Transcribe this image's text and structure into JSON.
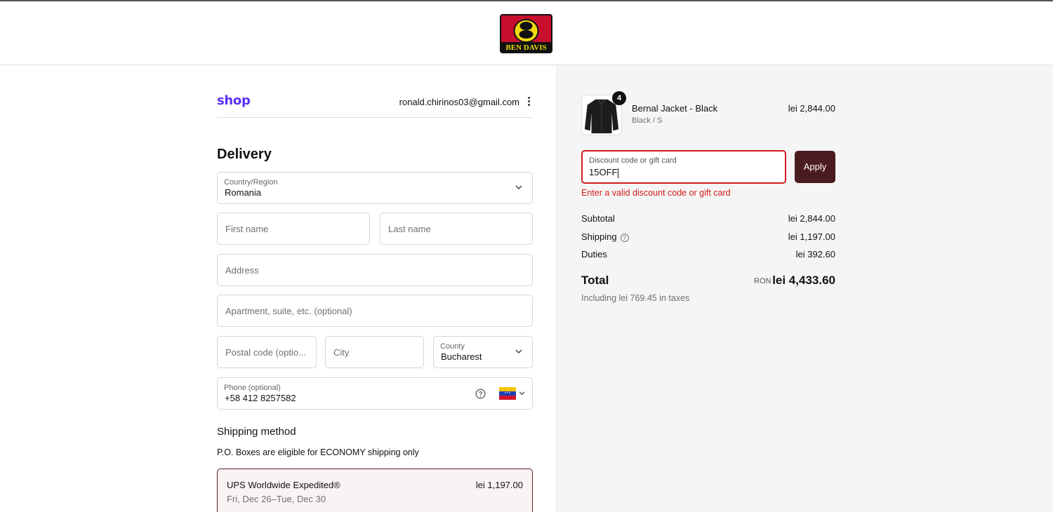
{
  "header": {
    "logo_text": "BEN DAVIS",
    "logo_alt": "Ben Davis logo"
  },
  "account": {
    "shop_label": "shop",
    "email": "ronald.chirinos03@gmail.com",
    "menu_icon": "kebab-menu-icon"
  },
  "delivery": {
    "title": "Delivery",
    "country": {
      "label": "Country/Region",
      "value": "Romania"
    },
    "first_name": {
      "placeholder": "First name"
    },
    "last_name": {
      "placeholder": "Last name"
    },
    "address": {
      "placeholder": "Address"
    },
    "apartment": {
      "placeholder": "Apartment, suite, etc. (optional)"
    },
    "postal": {
      "placeholder": "Postal code (optio..."
    },
    "city": {
      "placeholder": "City"
    },
    "county": {
      "label": "County",
      "value": "Bucharest"
    },
    "phone": {
      "label": "Phone (optional)",
      "value": "+58 412 8257582",
      "help_icon": "help-circle-icon",
      "flag": "venezuela-flag-icon"
    }
  },
  "shipping": {
    "title": "Shipping method",
    "note": "P.O. Boxes are eligible for ECONOMY shipping only",
    "option": {
      "name": "UPS Worldwide Expedited®",
      "date": "Fri, Dec 26–Tue, Dec 30",
      "price": "lei 1,197.00"
    }
  },
  "cart": {
    "item": {
      "quantity": "4",
      "name": "Bernal Jacket - Black",
      "variant": "Black / S",
      "price": "lei 2,844.00"
    }
  },
  "discount": {
    "label": "Discount code or gift card",
    "value": "15OFF",
    "apply_label": "Apply",
    "error": "Enter a valid discount code or gift card"
  },
  "summary": {
    "subtotal": {
      "label": "Subtotal",
      "value": "lei 2,844.00"
    },
    "shipping": {
      "label": "Shipping",
      "value": "lei 1,197.00"
    },
    "duties": {
      "label": "Duties",
      "value": "lei 392.60"
    },
    "total": {
      "label": "Total",
      "currency": "RON",
      "value": "lei 4,433.60"
    },
    "taxes": "Including lei 769.45 in taxes"
  },
  "colors": {
    "accent": "#4a1c1f",
    "error": "#d21c1c",
    "shop_brand": "#5a31f4"
  }
}
